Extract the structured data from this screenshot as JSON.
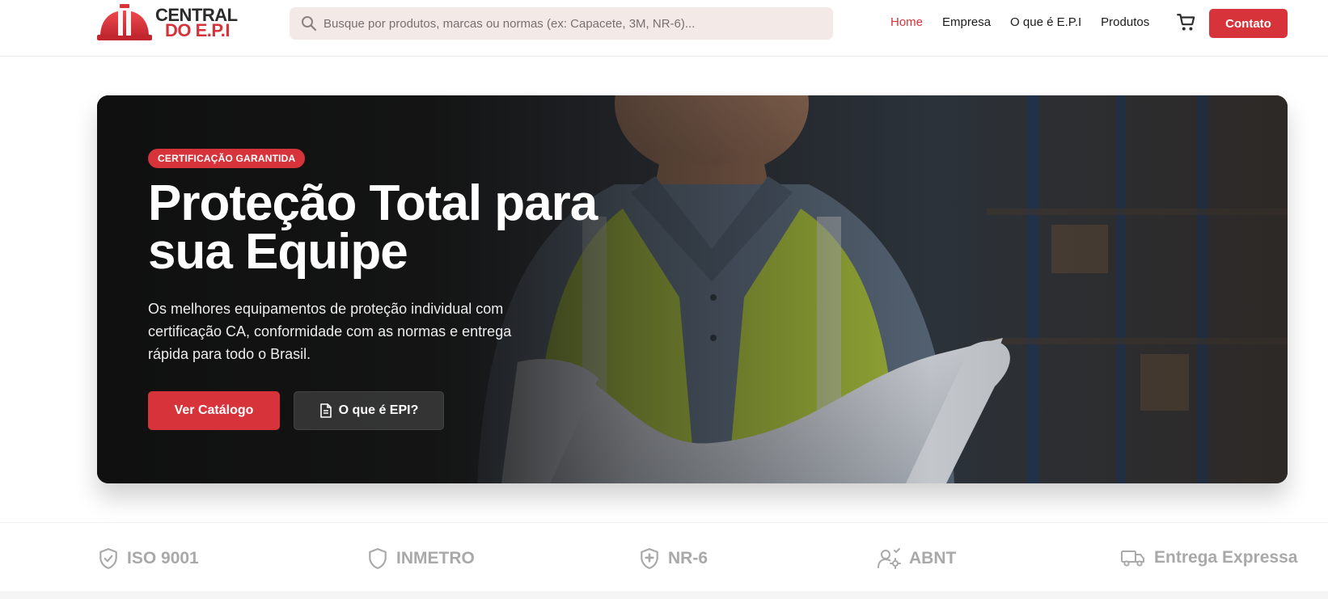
{
  "header": {
    "logo": {
      "line1": "CENTRAL",
      "line2": "DO E.P.I"
    },
    "search": {
      "placeholder": "Busque por produtos, marcas ou normas (ex: Capacete, 3M, NR-6)...",
      "icon": "search-icon"
    },
    "nav": [
      {
        "label": "Home",
        "active": true
      },
      {
        "label": "Empresa",
        "active": false
      },
      {
        "label": "O que é E.P.I",
        "active": false
      },
      {
        "label": "Produtos",
        "active": false
      }
    ],
    "cart_icon": "cart-icon",
    "contact_label": "Contato"
  },
  "hero": {
    "badge": "CERTIFICAÇÃO GARANTIDA",
    "title": "Proteção Total para sua Equipe",
    "description": "Os melhores equipamentos de proteção individual com certificação CA, conformidade com as normas e entrega rápida para todo o Brasil.",
    "primary_cta": "Ver Catálogo",
    "secondary_cta": {
      "label": "O que é EPI?",
      "icon": "document-icon"
    }
  },
  "certifications": [
    {
      "label": "ISO 9001",
      "icon": "shield-check-icon"
    },
    {
      "label": "INMETRO",
      "icon": "shield-icon"
    },
    {
      "label": "NR-6",
      "icon": "shield-plus-icon"
    },
    {
      "label": "ABNT",
      "icon": "user-gear-icon"
    },
    {
      "label": "Entrega Expressa",
      "icon": "truck-icon"
    }
  ],
  "colors": {
    "accent": "#d7333b",
    "text": "#1b1b1b",
    "muted": "#a9a9a9",
    "search_bg": "#f3e9e7"
  }
}
